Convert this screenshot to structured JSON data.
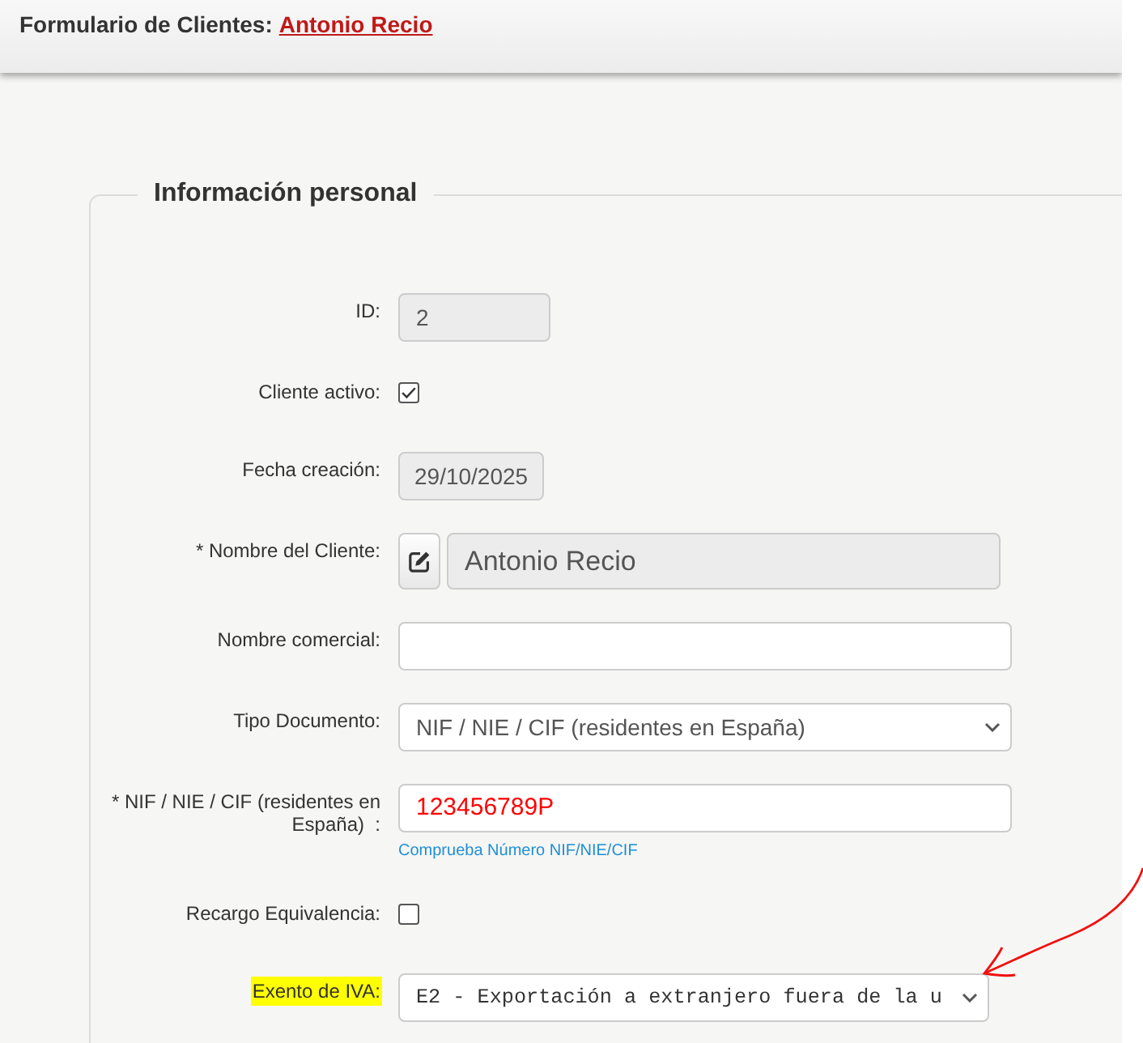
{
  "header": {
    "title": "Formulario de Clientes:",
    "client_link": "Antonio Recio"
  },
  "section": {
    "legend": "Información personal"
  },
  "fields": [
    {
      "kind": "number",
      "label": "ID:",
      "value": "2",
      "disabled": true,
      "invalid": false,
      "highlighted": false
    },
    {
      "kind": "checkbox",
      "label": "Cliente activo:",
      "checked": true,
      "highlighted": false
    },
    {
      "kind": "date",
      "label": "Fecha creación:",
      "value": "29/10/2025",
      "disabled": true,
      "invalid": false,
      "highlighted": false
    },
    {
      "kind": "editable",
      "label": "* Nombre del Cliente:",
      "value": "Antonio Recio",
      "disabled": true,
      "invalid": false,
      "highlighted": false
    },
    {
      "kind": "text",
      "label": "Nombre comercial:",
      "disabled": false,
      "highlighted": false
    },
    {
      "kind": "select",
      "label": "Tipo Documento:",
      "value": "NIF / NIE / CIF (residentes en España)",
      "highlighted": false
    },
    {
      "kind": "text",
      "label": "* NIF / NIE / CIF (residentes en España)  :",
      "value": "123456789P",
      "disabled": false,
      "invalid": true,
      "help_link": "Comprueba Número NIF/NIE/CIF",
      "highlighted": false
    },
    {
      "kind": "checkbox",
      "label": "Recargo Equivalencia:",
      "checked": false,
      "highlighted": false
    },
    {
      "kind": "codeselect",
      "label": "Exento de IVA:",
      "value": "E2 - Exportación a extranjero fuera de la u",
      "highlighted": true
    }
  ]
}
